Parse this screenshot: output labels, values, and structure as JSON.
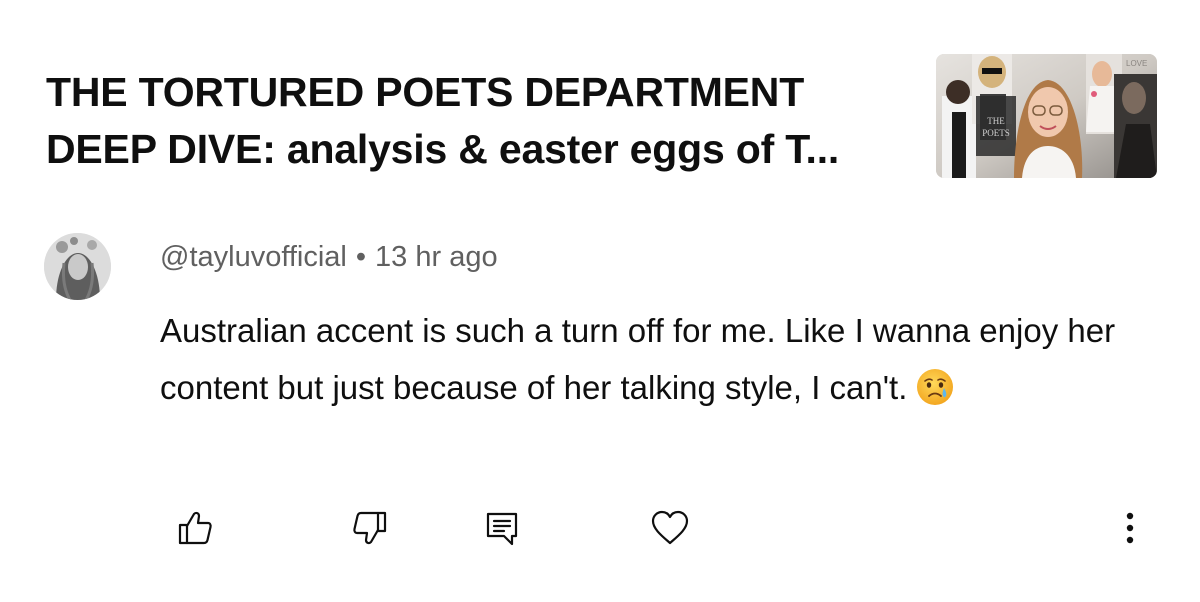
{
  "video": {
    "title": "THE TORTURED POETS DEPARTMENT DEEP DIVE: analysis & easter eggs of T...",
    "thumbnail_icon": "video-thumbnail"
  },
  "comment": {
    "author": "@tayluvofficial",
    "separator": "•",
    "time": "13 hr ago",
    "text": "Australian accent is such a turn off for me. Like I wanna enjoy her content but just because of her talking style, I can't.",
    "emoji": "crying-face-emoji"
  },
  "actions": {
    "like_icon": "thumbs-up-icon",
    "dislike_icon": "thumbs-down-icon",
    "reply_icon": "reply-icon",
    "heart_icon": "heart-icon",
    "more_icon": "more-vertical-icon"
  },
  "colors": {
    "text_primary": "#0f0f0f",
    "text_secondary": "#606060",
    "background": "#ffffff"
  }
}
